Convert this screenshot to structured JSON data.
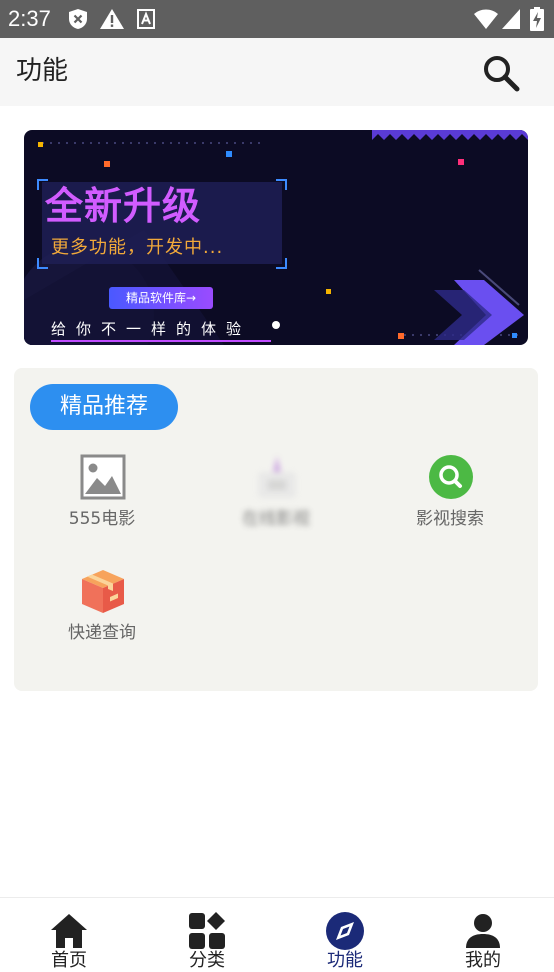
{
  "status_bar": {
    "time": "2:37",
    "icons": [
      "shield-x-icon",
      "warning-icon",
      "a-box-icon",
      "wifi-icon",
      "signal-icon",
      "battery-charging-icon"
    ]
  },
  "app_bar": {
    "title": "功能",
    "search_icon": "search-icon"
  },
  "banner": {
    "headline": "全新升级",
    "subheadline": "更多功能，开发中...",
    "button_label": "精品软件库→",
    "slogan": "给你不一样的体验",
    "colors": {
      "background": "#0c0b24",
      "headline": "#d15cff",
      "subheadline": "#f2a93a"
    }
  },
  "featured": {
    "badge": "精品推荐",
    "items": [
      {
        "label": "555电影",
        "icon": "image-placeholder-icon"
      },
      {
        "label": "在线影视",
        "icon": "video-icon"
      },
      {
        "label": "影视搜索",
        "icon": "search-circle-icon"
      },
      {
        "label": "快递查询",
        "icon": "package-icon"
      }
    ],
    "colors": {
      "badge": "#2d8ff0",
      "card": "#f3f3ef"
    }
  },
  "bottom_nav": {
    "items": [
      {
        "label": "首页",
        "icon": "home-icon"
      },
      {
        "label": "分类",
        "icon": "grid-icon"
      },
      {
        "label": "功能",
        "icon": "compass-icon",
        "active": true
      },
      {
        "label": "我的",
        "icon": "user-icon"
      }
    ],
    "active_color": "#1b2a78"
  }
}
